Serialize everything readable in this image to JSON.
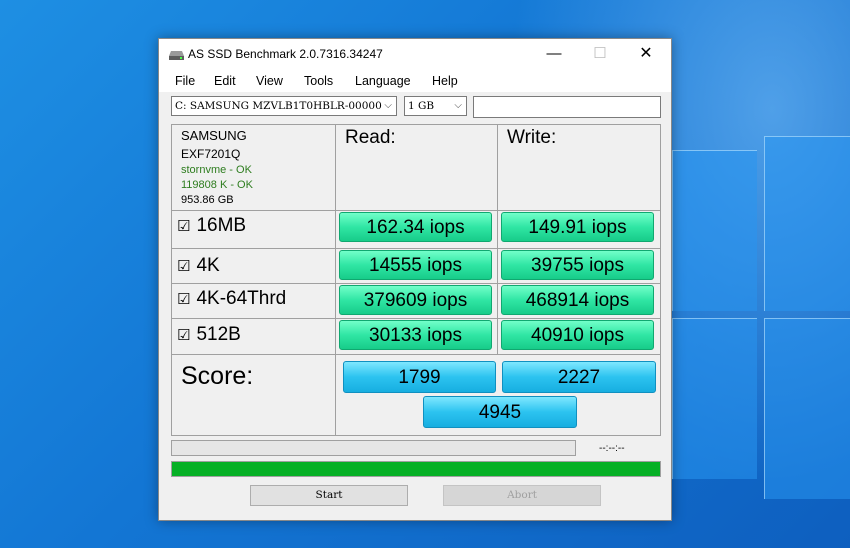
{
  "window": {
    "title": "AS SSD Benchmark 2.0.7316.34247"
  },
  "titlebar": {
    "minimize": "—",
    "maximize": "☐",
    "close": "✕"
  },
  "menu": [
    "File",
    "Edit",
    "View",
    "Tools",
    "Language",
    "Help"
  ],
  "drive_select": {
    "value": "C: SAMSUNG MZVLB1T0HBLR-00000"
  },
  "size_select": {
    "value": "1 GB"
  },
  "drive_info": {
    "vendor": "SAMSUNG",
    "firmware": "EXF7201Q",
    "driver": "stornvme - OK",
    "alignment": "119808 K - OK",
    "capacity": "953.86 GB"
  },
  "headers": {
    "read": "Read:",
    "write": "Write:"
  },
  "tests": [
    {
      "label": "16MB",
      "checked": true,
      "read": "162.34 iops",
      "write": "149.91 iops"
    },
    {
      "label": "4K",
      "checked": true,
      "read": "14555 iops",
      "write": "39755 iops"
    },
    {
      "label": "4K-64Thrd",
      "checked": true,
      "read": "379609 iops",
      "write": "468914 iops"
    },
    {
      "label": "512B",
      "checked": true,
      "read": "30133 iops",
      "write": "40910 iops"
    }
  ],
  "score": {
    "label": "Score:",
    "read": "1799",
    "write": "2227",
    "total": "4945"
  },
  "status": {
    "time": "--:--:--"
  },
  "progress": {
    "main_fraction": 1.0,
    "top_fraction": 0.0
  },
  "buttons": {
    "start": "Start",
    "abort": "Abort"
  },
  "colors": {
    "progress": "#06b025",
    "result": "#30e6a4",
    "score": "#2cc3f0"
  }
}
